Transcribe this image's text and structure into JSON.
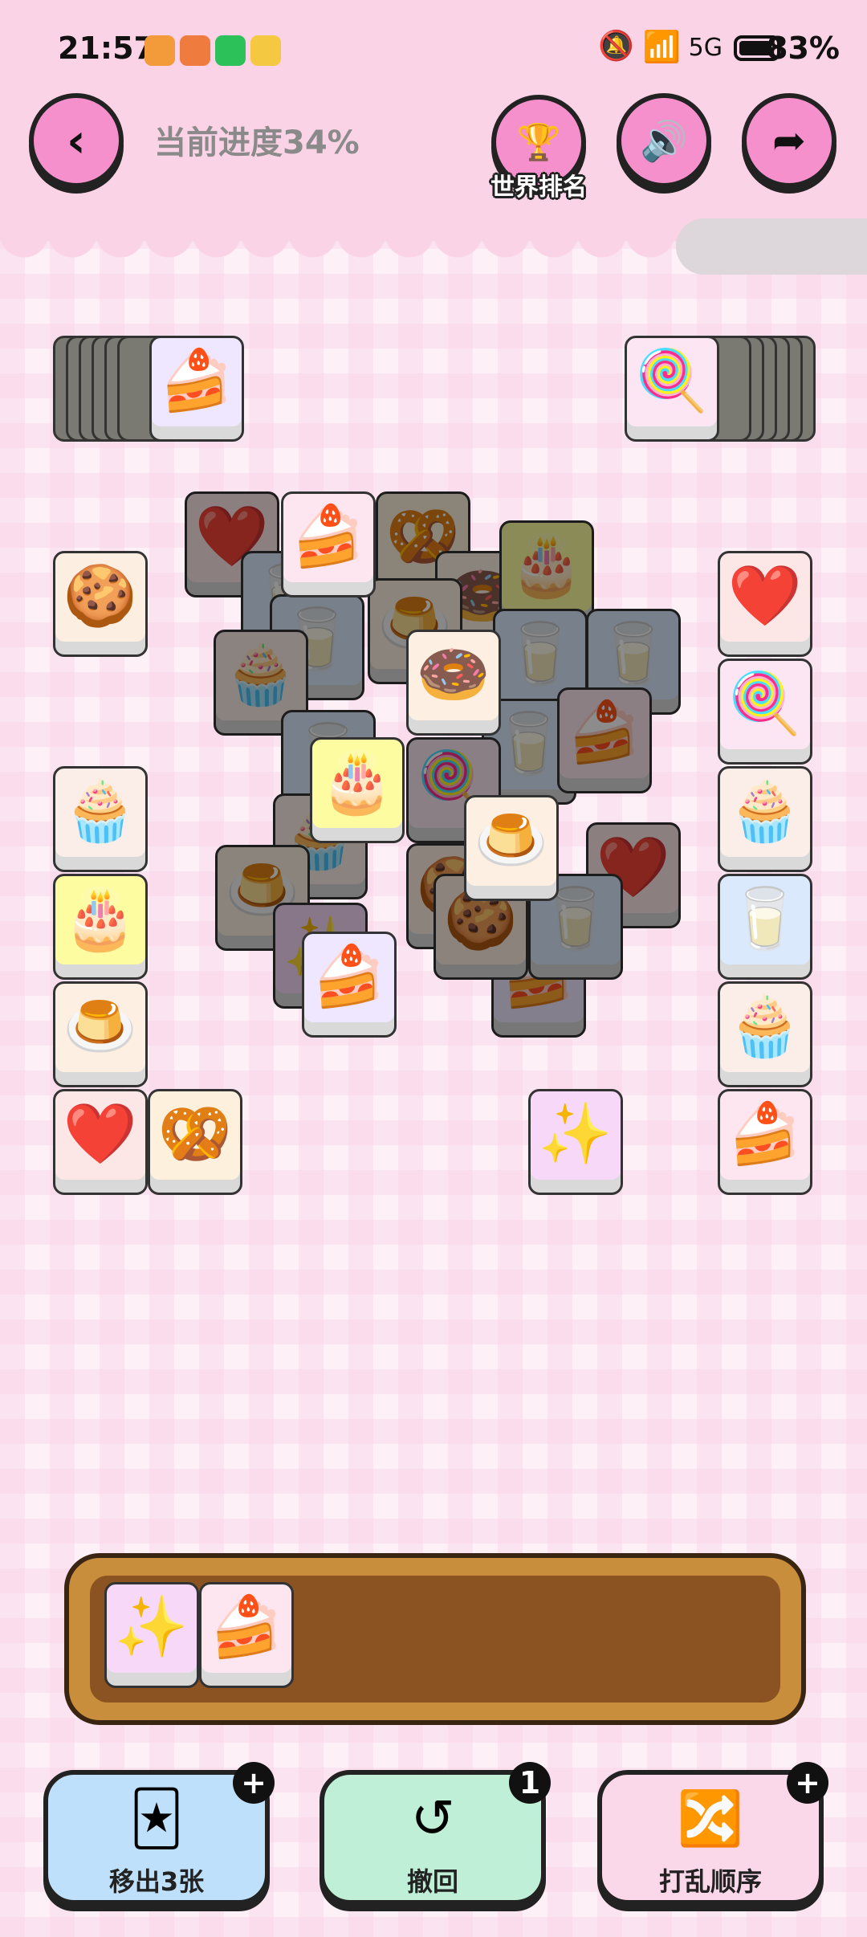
{
  "status_bar": {
    "time": "21:57",
    "battery": "83%",
    "network": "5G"
  },
  "header": {
    "progress": "当前进度34%",
    "rank_label": "世界排名"
  },
  "board": {
    "tile_icons": [
      "cookie",
      "cupcake",
      "yellow-cake",
      "pudding",
      "heart",
      "pretzel",
      "purple-cake",
      "heart-lollipop",
      "milk",
      "strawberry-cake",
      "donut",
      "sparkle"
    ]
  },
  "tray": {
    "slots": [
      "sparkle",
      "strawberry-cake"
    ]
  },
  "tools": {
    "remove": {
      "label": "移出3张",
      "badge": "+"
    },
    "undo": {
      "label": "撤回",
      "badge": "1"
    },
    "shuffle": {
      "label": "打乱顺序",
      "badge": "+"
    }
  },
  "colors": {
    "header_bg": "#fbd3e6",
    "button_pink": "#f590cc",
    "tool_blue": "#bfe0fa",
    "tool_green": "#bfefd6",
    "tool_pink": "#fbd7ea",
    "tray_wood": "#c98e3c"
  }
}
